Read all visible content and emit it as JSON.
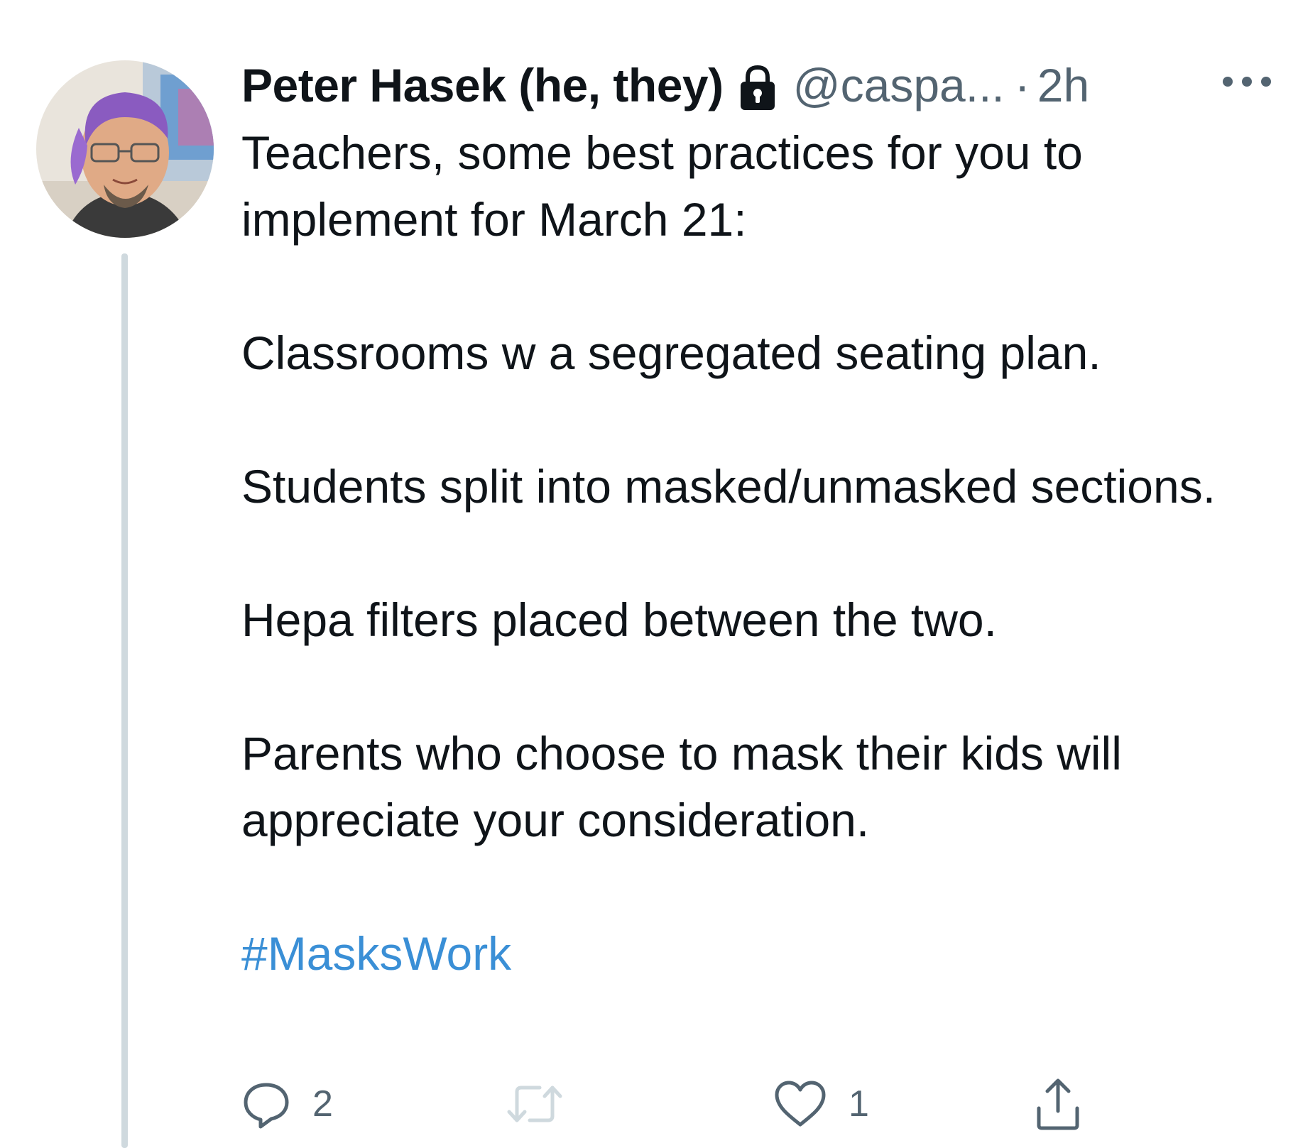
{
  "author": {
    "display_name": "Peter Hasek (he, they)",
    "handle": "@caspa...",
    "separator": "·",
    "time": "2h",
    "protected_icon": "lock-icon",
    "avatar": "profile-photo"
  },
  "tweet": {
    "paragraphs": [
      "Teachers, some best practices for you to implement for March 21:",
      "Classrooms w a segregated seating plan.",
      "Students split into masked/unmasked sections.",
      "Hepa filters placed between the two.",
      "Parents who choose to mask their kids will appreciate your consideration."
    ],
    "hashtag": "#MasksWork"
  },
  "actions": {
    "reply_count": "2",
    "retweet_count": "",
    "like_count": "1",
    "icons": [
      "reply-icon",
      "retweet-icon",
      "like-icon",
      "share-icon"
    ]
  },
  "colors": {
    "text": "#0f1419",
    "secondary": "#536471",
    "link": "#3a8fd6",
    "thread_line": "#cfd9de"
  }
}
